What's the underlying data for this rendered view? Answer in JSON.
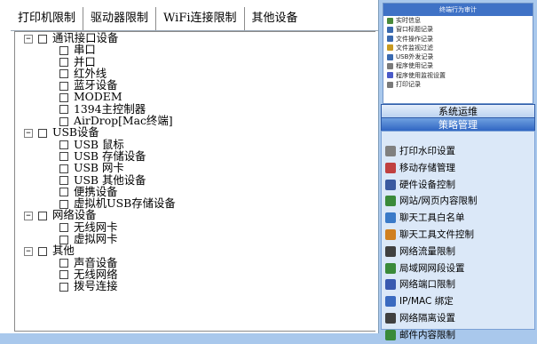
{
  "tabs": [
    "打印机限制",
    "驱动器限制",
    "WiFi连接限制",
    "其他设备"
  ],
  "tree": {
    "groups": [
      {
        "label": "通讯接口设备",
        "children": [
          "串口",
          "并口",
          "红外线",
          "蓝牙设备",
          "MODEM",
          "1394主控制器",
          "AirDrop[Mac终端]"
        ]
      },
      {
        "label": "USB设备",
        "children": [
          "USB 鼠标",
          "USB 存储设备",
          "USB 网卡",
          "USB 其他设备",
          "便携设备",
          "虚拟机USB存储设备"
        ]
      },
      {
        "label": "网络设备",
        "children": [
          "无线网卡",
          "虚拟网卡"
        ]
      },
      {
        "label": "其他",
        "children": [
          "声音设备",
          "无线网络",
          "拨号连接"
        ]
      }
    ]
  },
  "right": {
    "top_title": "终端行为审计",
    "top_items": [
      {
        "label": "实时信息",
        "icon": "monitor-icon",
        "color": "#4a8a3a"
      },
      {
        "label": "窗口标题记录",
        "icon": "window-icon",
        "color": "#3a6ab0"
      },
      {
        "label": "文件操作记录",
        "icon": "file-icon",
        "color": "#3a6ab0"
      },
      {
        "label": "文件监视过滤",
        "icon": "filter-icon",
        "color": "#c89a20"
      },
      {
        "label": "USB外发记录",
        "icon": "usb-icon",
        "color": "#3a6ab0"
      },
      {
        "label": "程序使用记录",
        "icon": "program-icon",
        "color": "#7a7a7a"
      },
      {
        "label": "程序使用监视设置",
        "icon": "settings-icon",
        "color": "#4a5ac8"
      },
      {
        "label": "打印记录",
        "icon": "printer-icon",
        "color": "#7a7a7a"
      }
    ],
    "section1": "系统运维",
    "section2": "策略管理",
    "menu": [
      {
        "label": "打印水印设置",
        "icon": "printer-icon",
        "color": "#808080"
      },
      {
        "label": "移动存储管理",
        "icon": "storage-icon",
        "color": "#c04040"
      },
      {
        "label": "硬件设备控制",
        "icon": "hardware-icon",
        "color": "#3a5aa0"
      },
      {
        "label": "网站/网页内容限制",
        "icon": "web-icon",
        "color": "#3a8a3a"
      },
      {
        "label": "聊天工具白名单",
        "icon": "chat-icon",
        "color": "#3a7ac8"
      },
      {
        "label": "聊天工具文件控制",
        "icon": "chat-file-icon",
        "color": "#d08020"
      },
      {
        "label": "网络流量限制",
        "icon": "traffic-icon",
        "color": "#404040"
      },
      {
        "label": "局域网网段设置",
        "icon": "lan-icon",
        "color": "#3a8a3a"
      },
      {
        "label": "网络端口限制",
        "icon": "port-icon",
        "color": "#3a5ab0"
      },
      {
        "label": "IP/MAC 绑定",
        "icon": "ipmac-icon",
        "color": "#3a6ac0"
      },
      {
        "label": "网络隔离设置",
        "icon": "isolation-icon",
        "color": "#404040"
      },
      {
        "label": "邮件内容限制",
        "icon": "mail-icon",
        "color": "#3a8a3a"
      }
    ]
  }
}
